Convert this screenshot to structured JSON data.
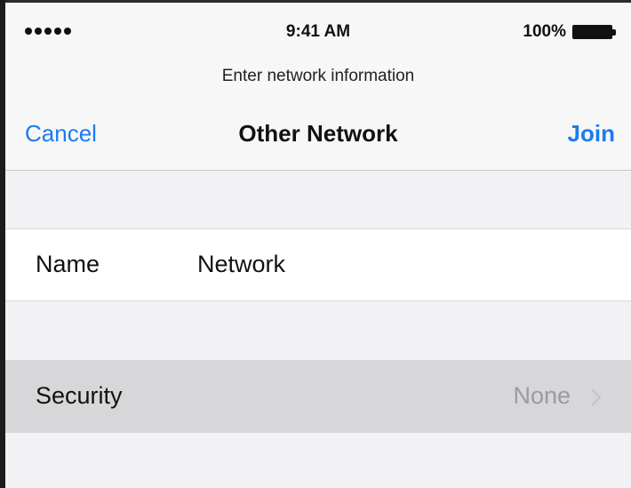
{
  "status_bar": {
    "time": "9:41 AM",
    "battery_percent": "100%",
    "signal_bars": 5
  },
  "prompt": {
    "text": "Enter network information"
  },
  "navbar": {
    "cancel_label": "Cancel",
    "title": "Other Network",
    "join_label": "Join"
  },
  "form": {
    "name": {
      "label": "Name",
      "value": "Network"
    },
    "security": {
      "label": "Security",
      "value": "None",
      "icon": "chevron-right-icon"
    }
  },
  "colors": {
    "accent": "#1a7cf0",
    "background": "#f2f2f4",
    "selected_row": "#d7d7d9",
    "secondary_text": "#9b9ba0"
  }
}
